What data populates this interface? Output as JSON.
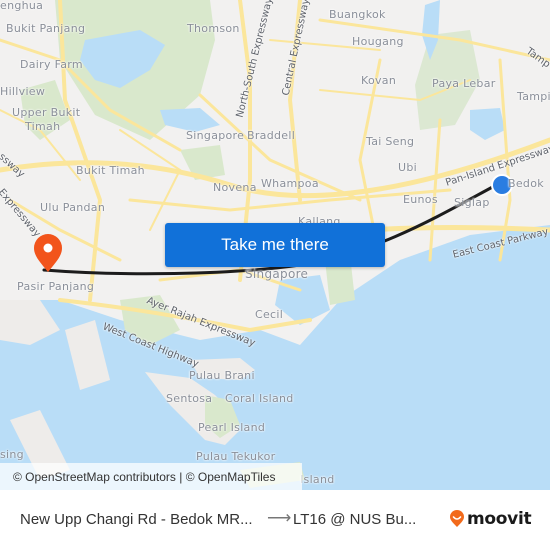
{
  "map": {
    "places": [
      {
        "id": "senghua",
        "label": "enghua"
      },
      {
        "id": "bukit-panjang",
        "label": "Bukit Panjang"
      },
      {
        "id": "dairy-farm",
        "label": "Dairy Farm"
      },
      {
        "id": "hillview",
        "label": "Hillview"
      },
      {
        "id": "upper-bukit-timah-1",
        "label": "Upper Bukit"
      },
      {
        "id": "upper-bukit-timah-2",
        "label": "Timah"
      },
      {
        "id": "thomson",
        "label": "Thomson"
      },
      {
        "id": "buangkok",
        "label": "Buangkok"
      },
      {
        "id": "hougang",
        "label": "Hougang"
      },
      {
        "id": "kovan",
        "label": "Kovan"
      },
      {
        "id": "paya-lebar",
        "label": "Paya Lebar"
      },
      {
        "id": "tampines",
        "label": "Tampi"
      },
      {
        "id": "singapore-north",
        "label": "Singapore"
      },
      {
        "id": "braddell",
        "label": "Braddell"
      },
      {
        "id": "tai-seng",
        "label": "Tai Seng"
      },
      {
        "id": "bukit-timah",
        "label": "Bukit Timah"
      },
      {
        "id": "novena",
        "label": "Novena"
      },
      {
        "id": "whampoa",
        "label": "Whampoa"
      },
      {
        "id": "ubi",
        "label": "Ubi"
      },
      {
        "id": "eunos",
        "label": "Eunos"
      },
      {
        "id": "siglap",
        "label": "Siglap"
      },
      {
        "id": "bedok",
        "label": "Bedok"
      },
      {
        "id": "ulu-pandan",
        "label": "Ulu Pandan"
      },
      {
        "id": "kallang",
        "label": "Kallang"
      },
      {
        "id": "singapore-city",
        "label": "Singapore"
      },
      {
        "id": "pasir-panjang",
        "label": "Pasir Panjang"
      },
      {
        "id": "cecil",
        "label": "Cecil"
      },
      {
        "id": "pulau-brani",
        "label": "Pulau Brani"
      },
      {
        "id": "sentosa",
        "label": "Sentosa"
      },
      {
        "id": "coral-island",
        "label": "Coral Island"
      },
      {
        "id": "pearl-island",
        "label": "Pearl Island"
      },
      {
        "id": "pulau-tekukor",
        "label": "Pulau Tekukor"
      },
      {
        "id": "sing",
        "label": "sing"
      },
      {
        "id": "island-s",
        "label": "Island"
      }
    ],
    "roads": [
      {
        "id": "north-south-expressway",
        "label": "North-South Expressway"
      },
      {
        "id": "central-expressway",
        "label": "Central Expressway"
      },
      {
        "id": "pan-island-expressway",
        "label": "Pan-Island Expressway"
      },
      {
        "id": "east-coast-parkway",
        "label": "East Coast Parkway"
      },
      {
        "id": "ayer-rajah-expressway",
        "label": "Ayer Rajah Expressway"
      },
      {
        "id": "west-coast-highway",
        "label": "West Coast Highway"
      },
      {
        "id": "tampines-road",
        "label": "Tamp"
      },
      {
        "id": "expressway-west",
        "label": "Expressway"
      },
      {
        "id": "ssway-nw",
        "label": "ssway"
      }
    ],
    "origin_marker": {
      "label": "origin",
      "color": "#2a7de1"
    },
    "destination_marker": {
      "label": "destination",
      "color": "#f2541b"
    },
    "route_color": "#1c1c1c",
    "colors": {
      "land": "#f2f1f0",
      "water": "#b9ddf7",
      "park": "#d9e8cc",
      "road": "#fbe69b"
    }
  },
  "cta": {
    "label": "Take me there",
    "color": "#1171d9"
  },
  "attribution": {
    "text": "© OpenStreetMap contributors | © OpenMapTiles"
  },
  "footer": {
    "from": "New Upp Changi Rd - Bedok MR...",
    "arrow": "⟶",
    "to": "LT16 @ NUS Bu...",
    "brand": "moovit",
    "brand_color": "#f26a1b"
  }
}
